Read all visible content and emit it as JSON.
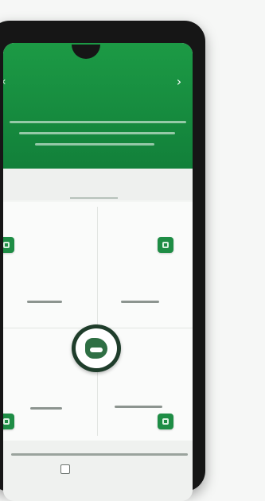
{
  "header": {
    "title": "",
    "back_icon": "chevron-right-icon"
  },
  "tabs": [
    {
      "label": ""
    },
    {
      "label": ""
    },
    {
      "label": ""
    }
  ],
  "cells": [
    {
      "icon": "app-icon",
      "label": ""
    },
    {
      "icon": "app-icon",
      "label": ""
    },
    {
      "icon": "app-icon",
      "label": ""
    },
    {
      "icon": "app-icon",
      "label": ""
    }
  ],
  "footer": {
    "note": "",
    "consent_label": ""
  },
  "colors": {
    "primary": "#1c9a45",
    "primary_dark": "#12803a",
    "background": "#f4f6f4"
  }
}
